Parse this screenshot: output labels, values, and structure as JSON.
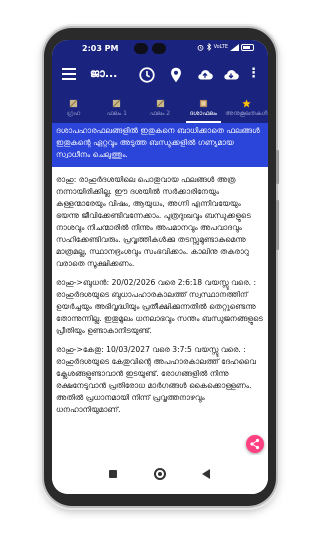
{
  "status_bar": {
    "time": "2:03 PM",
    "icons": [
      "alarm-icon",
      "bluetooth-icon",
      "volte-icon",
      "signal-icon",
      "battery-icon"
    ],
    "network_label": "VoLTE"
  },
  "app_bar": {
    "title": "ജാ...",
    "actions": [
      "clock-icon",
      "location-pin-icon",
      "cloud-upload-icon",
      "cloud-download-icon",
      "more-vert-icon"
    ],
    "more_glyph": "⋮"
  },
  "tabs": [
    {
      "label": "ഗ്രഹ",
      "icon": "chart-icon",
      "active": false
    },
    {
      "label": "ഫലം 1",
      "icon": "chart-icon",
      "active": false
    },
    {
      "label": "ഫലം 2",
      "icon": "chart-icon",
      "active": false
    },
    {
      "label": "ദശാഫലം",
      "icon": "book-icon",
      "active": true
    },
    {
      "label": "അനുകൂലതകൾ",
      "icon": "star-icon",
      "active": false
    }
  ],
  "content": {
    "highlight_text": "ദശാപഹാരഫലങ്ങളിൽ ഇതുകനെ ബാധിക്കാതെ ഫലങ്ങൾ ഇതുകന്റെ ഏറ്റവും അടുത്ത ബന്ധുക്കളിൽ ഗണ്യമായ സ്വാധീനം ചെലുത്തും.",
    "paragraphs": [
      "രാഹു: രാഹുർദശയിലെ പൊതുവായ ഫലങ്ങൾ അത്ര നന്നായിരിക്കില്ല. ഈ ദശയിൽ സർക്കാരിനേയും കള്ളന്മാരേയും വിഷം, ആയുധം, അഗ്നി എന്നിവയേയും ഭയന്നു ജീവിക്കേണ്ടിവന്നേക്കാം. പുത്രദുഃഖവും ബന്ധുക്കളുടെ നാശവും നിചന്മാരിൽ നിന്നും അപമാനവും അപവാദവും സഹിക്കേണ്ടിവരും. പ്രവൃത്തികൾക്കു തടസ്സമുണ്ടാകുമെന്നു മാത്രമല്ല, സ്ഥാനഭ്രംശവും സംഭവിക്കാം. കാലിനു തകരാറു വരാതെ സൂക്ഷിക്കണം.",
      "രാഹു->ബുധൻ: 20/02/2026 വരെ 2:6:18 വയസ്സു വരെ. : രാഹുർദശയുടെ ബുധാപഹാരകാലത്ത് സ്വസ്ഥാനത്തിന് ഉയർച്ചയും അഭിവൃദ്ധിയും പ്രതീക്ഷിക്കുന്നതിൽ തെറ്റുണ്ടെന്നു തോന്നുന്നില്ല. ഇതുമൂലം ധനലാഭവും സന്തം ബന്ധുജനങ്ങളുടെ പ്രീതിയും ഉണ്ടാകാനിടയുണ്ട്.",
      "രാഹു->കേതു: 10/03/2027 വരെ 3:7:5 വയസ്സു വരെ. : രാഹുർദശയുടെ കേതുവിന്റെ അപഹാരകാലത്ത് ദേഹവൈ ക്ലേശങ്ങളുണ്ടാവാൻ ഇടയുണ്ട്. രോഗങ്ങളിൽ നിന്നു രക്ഷനേടുവാൻ പ്രതിരോധ മാർഗങ്ങൾ കൈക്കൊള്ളണം. അതിൽ പ്രധാനമായി നിന്ന് പ്രവൃത്തനാഴവും ധനഹാനിയുമാണ്."
    ]
  },
  "fab": {
    "icon": "share-icon"
  },
  "nav_bar": {
    "buttons": [
      "recent-apps-icon",
      "home-icon",
      "back-icon"
    ]
  },
  "colors": {
    "primary": "#1a237e",
    "highlight": "#2b44d9",
    "accent": "#ff4081",
    "star": "#ffc107"
  }
}
